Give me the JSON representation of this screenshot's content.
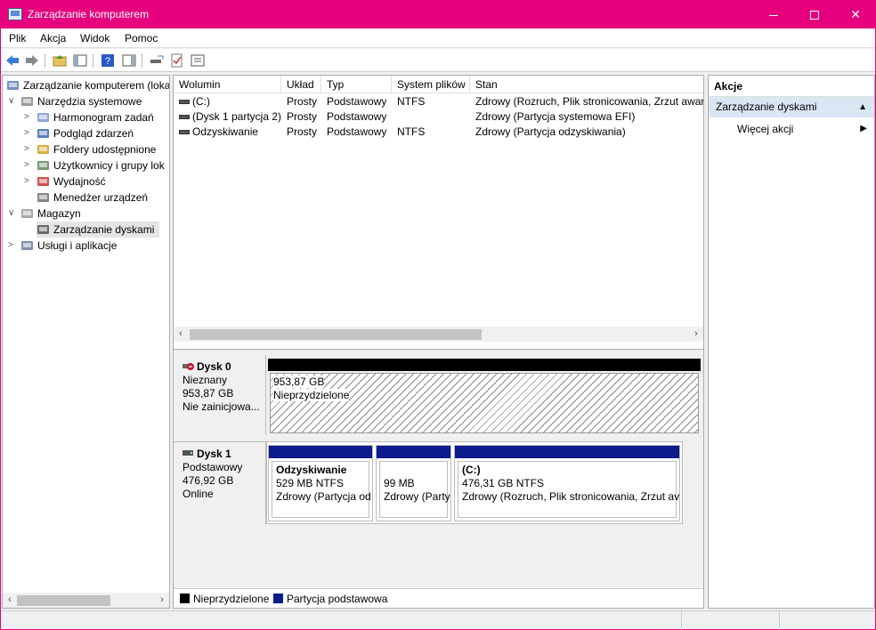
{
  "window": {
    "title": "Zarządzanie komputerem"
  },
  "menu": [
    "Plik",
    "Akcja",
    "Widok",
    "Pomoc"
  ],
  "tree": [
    {
      "label": "Zarządzanie komputerem (loka",
      "level": 0,
      "icon": "computer-management-icon",
      "chevron": ""
    },
    {
      "label": "Narzędzia systemowe",
      "level": 1,
      "icon": "system-tools-icon",
      "chevron": "∨"
    },
    {
      "label": "Harmonogram zadań",
      "level": 2,
      "icon": "task-scheduler-icon",
      "chevron": ">"
    },
    {
      "label": "Podgląd zdarzeń",
      "level": 2,
      "icon": "event-viewer-icon",
      "chevron": ">"
    },
    {
      "label": "Foldery udostępnione",
      "level": 2,
      "icon": "shared-folders-icon",
      "chevron": ">"
    },
    {
      "label": "Użytkownicy i grupy lok",
      "level": 2,
      "icon": "users-groups-icon",
      "chevron": ">"
    },
    {
      "label": "Wydajność",
      "level": 2,
      "icon": "performance-icon",
      "chevron": ">"
    },
    {
      "label": "Menedżer urządzeń",
      "level": 2,
      "icon": "device-manager-icon",
      "chevron": ""
    },
    {
      "label": "Magazyn",
      "level": 1,
      "icon": "storage-icon",
      "chevron": "∨"
    },
    {
      "label": "Zarządzanie dyskami",
      "level": 2,
      "icon": "disk-management-icon",
      "chevron": "",
      "selected": true
    },
    {
      "label": "Usługi i aplikacje",
      "level": 1,
      "icon": "services-apps-icon",
      "chevron": ">"
    }
  ],
  "volumes": {
    "columns": [
      "Wolumin",
      "Układ",
      "Typ",
      "System plików",
      "Stan"
    ],
    "rows": [
      [
        "(C:)",
        "Prosty",
        "Podstawowy",
        "NTFS",
        "Zdrowy (Rozruch, Plik stronicowania, Zrzut awary"
      ],
      [
        "(Dysk 1 partycja 2)",
        "Prosty",
        "Podstawowy",
        "",
        "Zdrowy (Partycja systemowa EFI)"
      ],
      [
        "Odzyskiwanie",
        "Prosty",
        "Podstawowy",
        "NTFS",
        "Zdrowy (Partycja odzyskiwania)"
      ]
    ]
  },
  "disks": [
    {
      "name": "Dysk 0",
      "type": "Nieznany",
      "size": "953,87 GB",
      "status": "Nie zainicjowa...",
      "partitions": [
        {
          "name": "",
          "size": "953,87 GB",
          "status": "Nieprzydzielone"
        }
      ]
    },
    {
      "name": "Dysk 1",
      "type": "Podstawowy",
      "size": "476,92 GB",
      "status": "Online",
      "partitions": [
        {
          "name": "Odzyskiwanie",
          "size": "529 MB NTFS",
          "status": "Zdrowy (Partycja od"
        },
        {
          "name": "",
          "size": "99 MB",
          "status": "Zdrowy (Party"
        },
        {
          "name": "(C:)",
          "size": "476,31 GB NTFS",
          "status": "Zdrowy (Rozruch, Plik stronicowania, Zrzut av"
        }
      ]
    }
  ],
  "legend": [
    {
      "label": "Nieprzydzielone",
      "color": "#000000"
    },
    {
      "label": "Partycja podstawowa",
      "color": "#0c1c8c"
    }
  ],
  "actions": {
    "header": "Akcje",
    "section": "Zarządzanie dyskami",
    "more": "Więcej akcji"
  },
  "colors": {
    "titlebar": "#e6007e",
    "primary_partition": "#0c1c8c",
    "unallocated": "#000000"
  }
}
